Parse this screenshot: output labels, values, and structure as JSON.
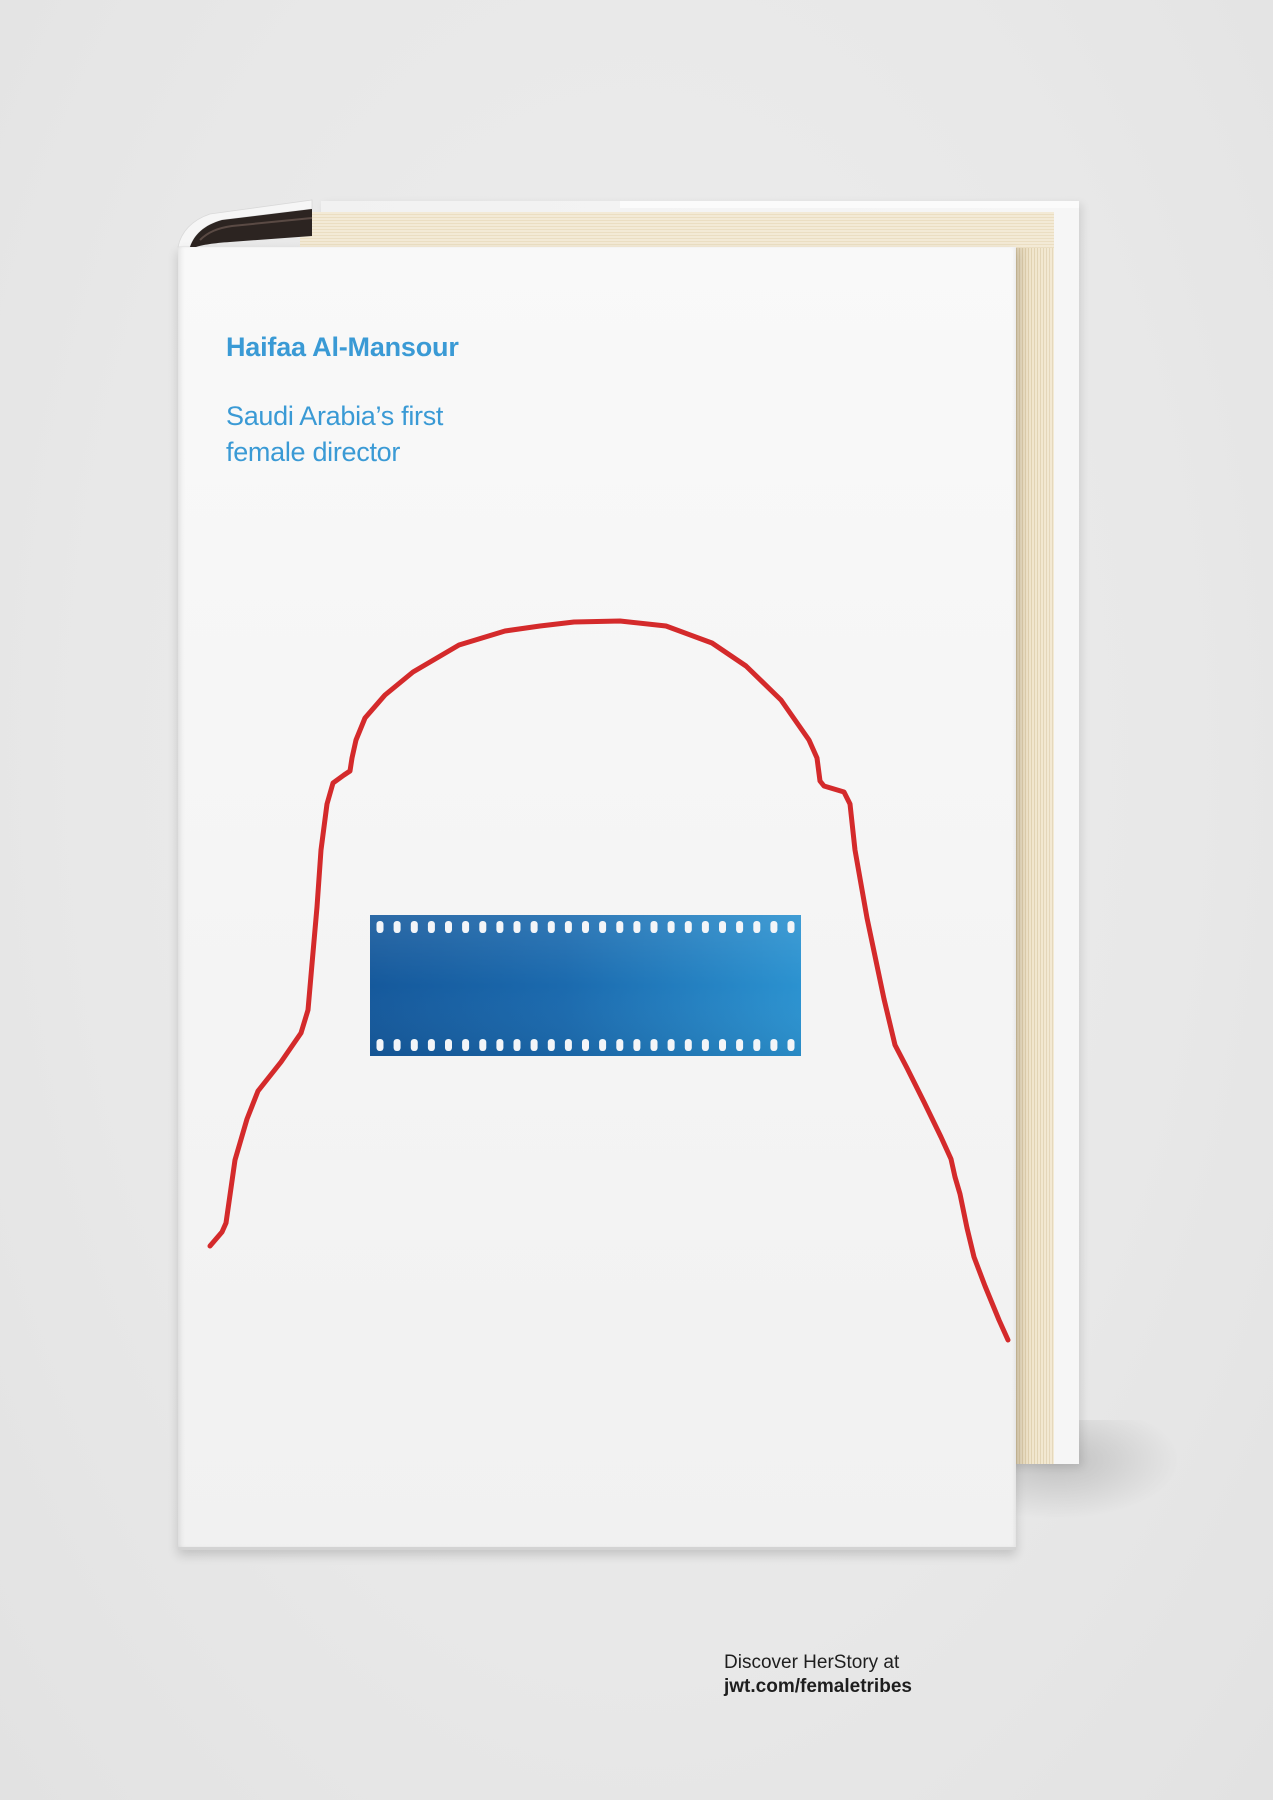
{
  "book": {
    "author_name": "Haifaa Al-Mansour",
    "subtitle_lines": [
      "Saudi Arabia’s first",
      "female director"
    ]
  },
  "footer": {
    "line1": "Discover HerStory at",
    "line2": "jwt.com/femaletribes"
  },
  "graphics": {
    "silhouette": "niqab-silhouette-outline",
    "film": "film-strip"
  },
  "colors": {
    "background": "#e8e8e8",
    "cover": "#f7f7f7",
    "title_text": "#3a9ad5",
    "outline_red": "#d42a2b",
    "film_blue_dark": "#15599c",
    "film_blue_light": "#2b92d0",
    "pages": "#f1e6cd",
    "footer_text": "#1e1e1e"
  }
}
